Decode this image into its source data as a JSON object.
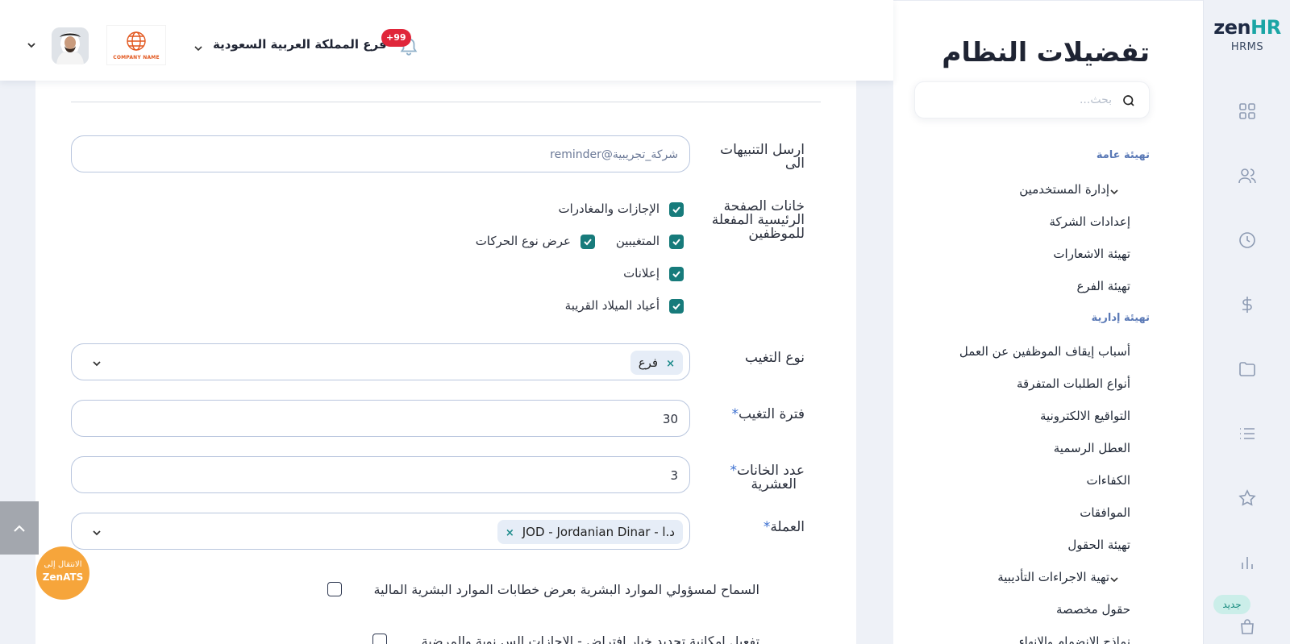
{
  "brand": {
    "name_zen": "zen",
    "name_hr": "HR",
    "sub": "HRMS"
  },
  "rail": {
    "icons": [
      "grid-icon",
      "users-icon",
      "clock-icon",
      "dollar-icon",
      "folder-icon",
      "list-icon",
      "star-icon",
      "bar-chart-icon",
      "bag-icon"
    ],
    "new_badge": "جديد"
  },
  "header": {
    "branch": "فرع المملكة العربية السعودية",
    "notifications": "+99",
    "company_logo_text": "COMPANY NAME"
  },
  "preferences": {
    "title": "تفضيلات النظام",
    "search_placeholder": "بحث...",
    "general_heading": "تهيئة عامة",
    "general_items": [
      "إدارة المستخدمين",
      "إعدادات الشركة",
      "تهيئة الاشعارات",
      "تهيئة الفرع"
    ],
    "admin_heading": "تهيئة إدارية",
    "admin_items": [
      "أسباب إيقاف الموظفين عن العمل",
      "أنواع الطلبات المتفرقة",
      "التواقيع الالكترونية",
      "العطل الرسمية",
      "الكفاءات",
      "الموافقات",
      "تهيئة الحقول",
      "تهية الاجراءات التأديبية",
      "حقول مخصصة",
      "نماذج الانضمام والانهاء"
    ]
  },
  "form": {
    "send_alerts_label_1": "ارسل التنبيهات",
    "send_alerts_label_2": "الى",
    "send_alerts_value": "reminder@شركة_تجريبية",
    "homepage_label_1": "خانات الصفحة",
    "homepage_label_2": "الرئيسية المفعلة",
    "homepage_label_3": "للموظفين",
    "cb_leaves": "الإجازات والمغادرات",
    "cb_absent": "المتغيبين",
    "cb_movement_type": "عرض نوع الحركات",
    "cb_announcements": "إعلانات",
    "cb_birthdays": "أعياد الميلاد القريبة",
    "absence_type_label": "نوع التغيب",
    "absence_type_tag": "فرع",
    "absence_period_label": "فترة التغيب",
    "absence_period_value": "30",
    "decimals_label_1": "عدد الخانات",
    "decimals_label_2": "العشرية",
    "decimals_value": "3",
    "currency_label": "العملة",
    "currency_tag": "JOD - Jordanian Dinar - د.ا",
    "required_mark": "*",
    "allow_hr_letters": "السماح لمسؤولي الموارد البشرية بعرض خطابات الموارد البشرية المالية",
    "enable_default_leave": "تفعيل امكانية تحديد خيار افتراض - الاجازات الس نوية والمرضية"
  },
  "zenats": {
    "line1": "الانتقال إلى",
    "line2": "ZenATS"
  }
}
